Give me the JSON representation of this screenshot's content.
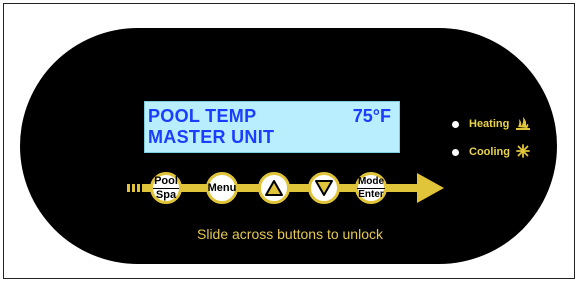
{
  "display": {
    "line1": "POOL TEMP",
    "temperature": "75°F",
    "line2": "MASTER UNIT"
  },
  "status": {
    "heating_label": "Heating",
    "cooling_label": "Cooling"
  },
  "buttons": {
    "pool_top": "Pool",
    "pool_bottom": "Spa",
    "menu": "Menu",
    "mode_top": "Mode",
    "mode_bottom": "Enter"
  },
  "hint": "Slide across buttons to unlock",
  "colors": {
    "panel": "#000000",
    "lcd_background": "#b9eeff",
    "lcd_text": "#1a3dff",
    "accent_yellow": "#e0c43a"
  },
  "icons": {
    "heating": "flame-icon",
    "cooling": "snowflake-icon",
    "up": "triangle-up-icon",
    "down": "triangle-down-icon",
    "arrow": "slide-arrow-icon"
  }
}
